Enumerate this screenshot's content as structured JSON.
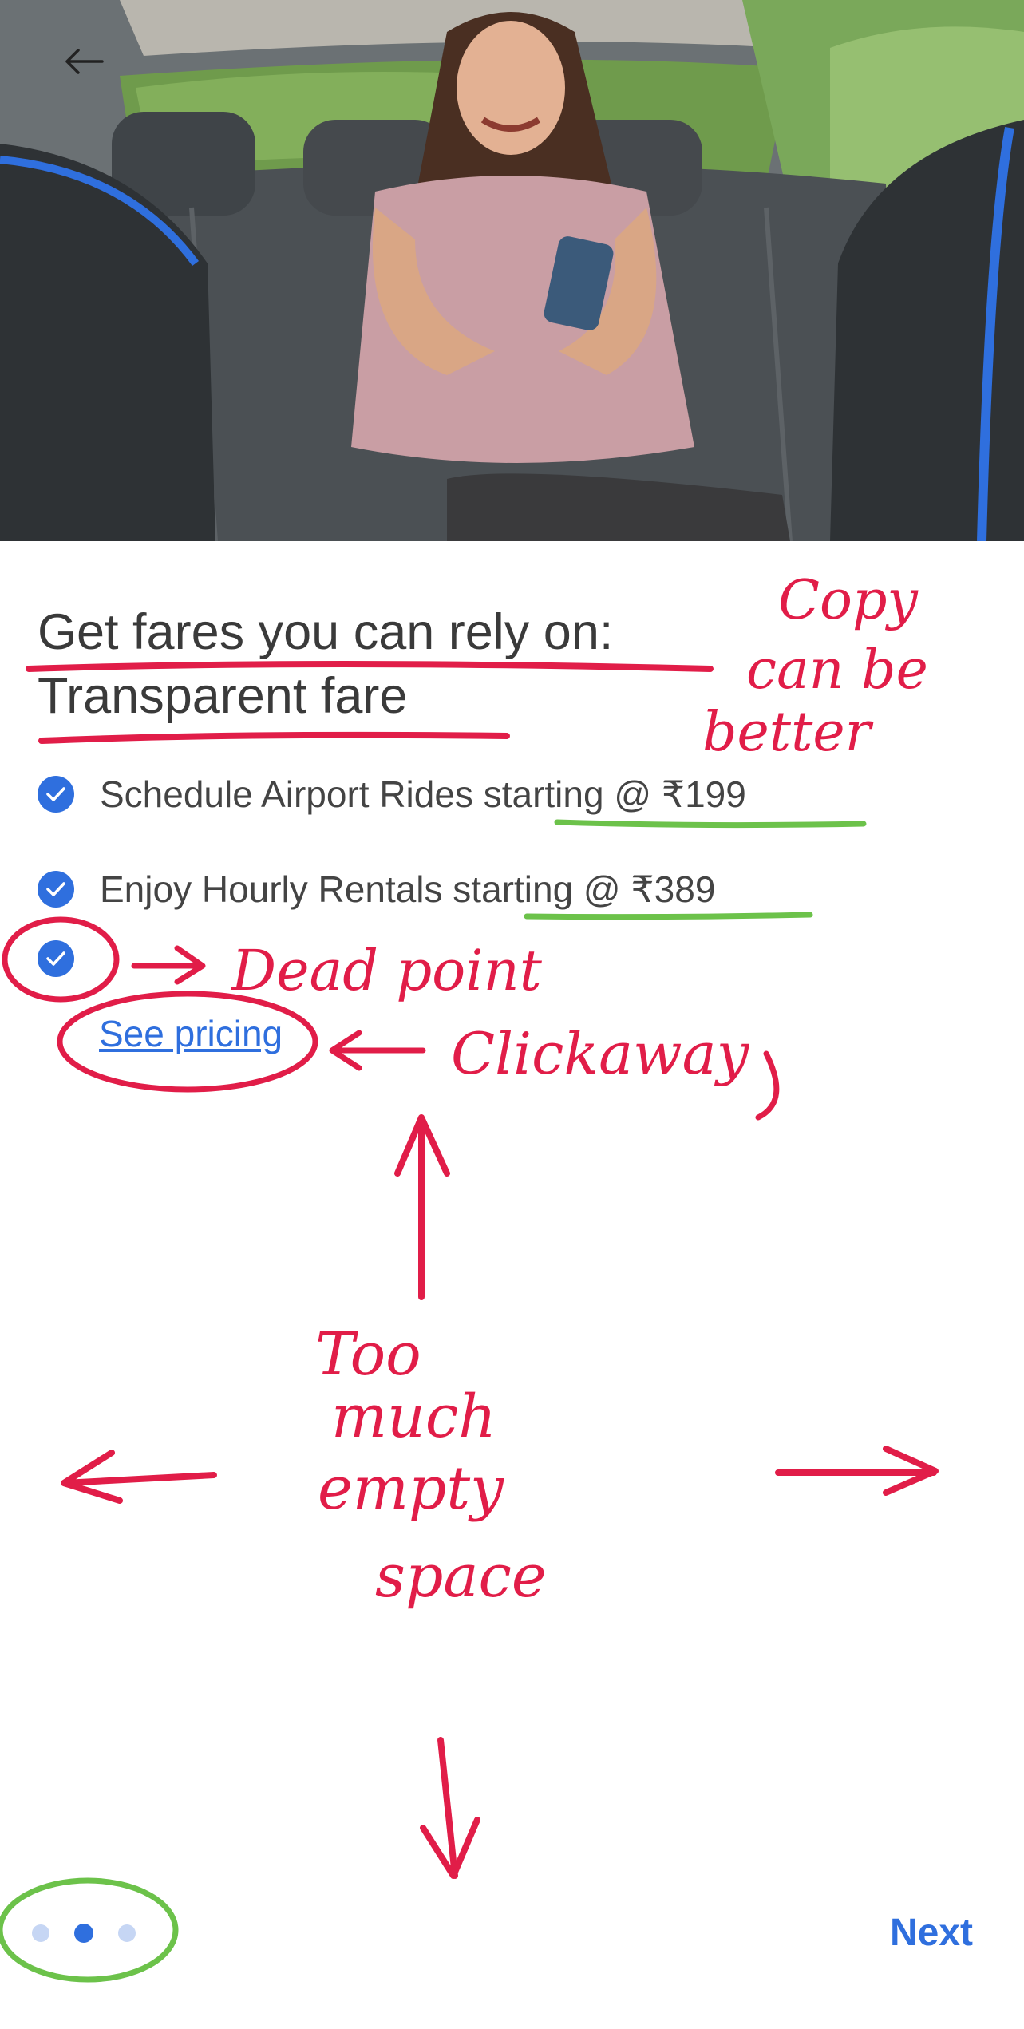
{
  "hero": {
    "back_icon": "arrow-left-icon"
  },
  "title": {
    "line1": "Get fares you can rely on:",
    "line2": "Transparent fare"
  },
  "features": [
    {
      "text": "Schedule Airport Rides starting @ ₹199",
      "icon": "check-circle-icon"
    },
    {
      "text": "Enjoy Hourly Rentals starting @ ₹389",
      "icon": "check-circle-icon"
    },
    {
      "text": "",
      "icon": "check-circle-icon"
    }
  ],
  "see_pricing": "See pricing",
  "pager": {
    "count": 3,
    "active_index": 1
  },
  "next_label": "Next",
  "annotations": {
    "copy_note": [
      "Copy",
      "can be",
      "better"
    ],
    "dead_point": "Dead point",
    "clickaway": "Clickaway",
    "empty_space": [
      "Too",
      "much",
      "empty",
      "space"
    ]
  },
  "colors": {
    "accent": "#2f6fde",
    "annotation_red": "#e11d48",
    "annotation_green": "#6cc24a"
  }
}
